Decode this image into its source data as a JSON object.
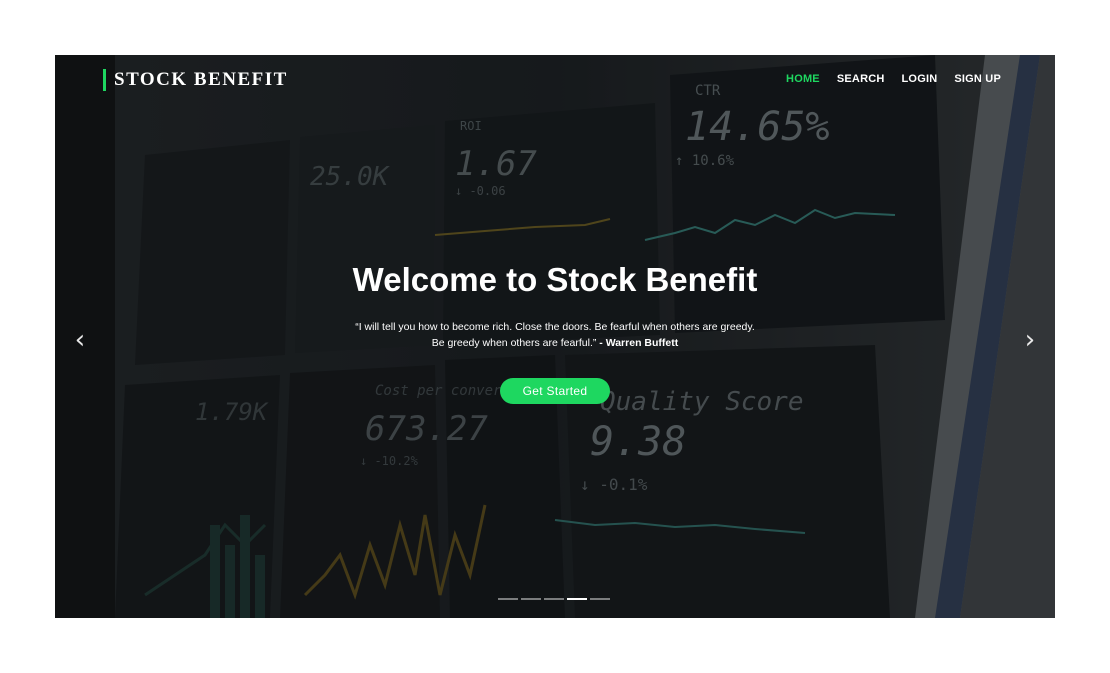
{
  "header": {
    "brand": "STOCK BENEFIT",
    "nav": [
      {
        "label": "HOME",
        "active": true
      },
      {
        "label": "SEARCH",
        "active": false
      },
      {
        "label": "LOGIN",
        "active": false
      },
      {
        "label": "SIGN UP",
        "active": false
      }
    ]
  },
  "hero": {
    "title": "Welcome to Stock Benefit",
    "quote_text": "“I will tell you how to become rich. Close the doors. Be fearful when others are greedy. Be greedy when others are fearful.”",
    "quote_author": "- Warren Buffett",
    "cta_label": "Get Started",
    "prev_glyph": "‹",
    "next_glyph": "›",
    "slides": 5,
    "active_slide": 4
  },
  "background_dashboard": {
    "ctr_label": "CTR",
    "ctr_value": "14.65%",
    "ctr_change": "↑ 10.6%",
    "score_label": "Quality Score",
    "score_value": "9.38",
    "score_change": "↓ -0.1%",
    "cost_label": "Cost per conversion",
    "cost_value": "673.27",
    "cost_change": "↓ -10.2%",
    "tile_value_a": "1.67",
    "tile_change_a": "↓ -0.06",
    "tile_value_b": "25.0K",
    "tile_value_c": "1.79K"
  },
  "colors": {
    "accent": "#1ed760",
    "overlay": "#000000",
    "text": "#ffffff"
  }
}
